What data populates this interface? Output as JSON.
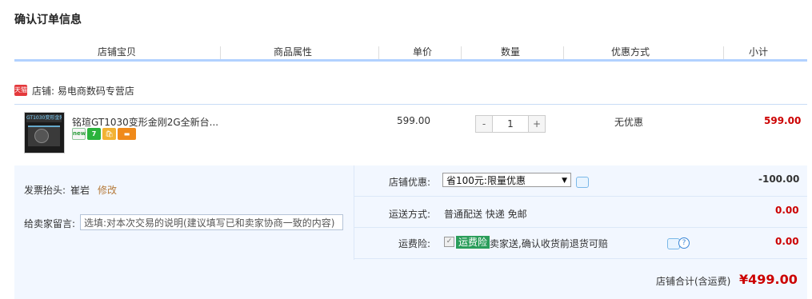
{
  "page_title": "确认订单信息",
  "columns": [
    "店铺宝贝",
    "商品属性",
    "单价",
    "数量",
    "优惠方式",
    "小计"
  ],
  "shop": {
    "icon_text": "天猫",
    "label": "店铺: 易电商数码专营店"
  },
  "item": {
    "thumb_text": "GT1030变形金刚2G",
    "title": "铭瑄GT1030变形金刚2G全新台...",
    "badges": {
      "new": "new",
      "seven": "7",
      "bag": "🛍",
      "card": "▬"
    },
    "price": "599.00",
    "qty_minus": "-",
    "quantity": "1",
    "qty_plus": "+",
    "promotion": "无优惠",
    "subtotal": "599.00"
  },
  "invoice": {
    "label": "发票抬头:",
    "name": "崔岩",
    "edit": "修改"
  },
  "message": {
    "label": "给卖家留言:",
    "placeholder": "选填:对本次交易的说明(建议填写已和卖家协商一致的内容)"
  },
  "shop_discount": {
    "label": "店铺优惠:",
    "selected": "省100元:限量优惠",
    "amount": "-100.00"
  },
  "shipping": {
    "label": "运送方式:",
    "value": "普通配送 快递 免邮",
    "amount": "0.00"
  },
  "insurance": {
    "label": "运费险:",
    "tag": "运费险",
    "desc": "卖家送,确认收货前退货可赔",
    "amount": "0.00"
  },
  "total": {
    "label": "店铺合计(含运费)",
    "amount": "¥499.00"
  }
}
